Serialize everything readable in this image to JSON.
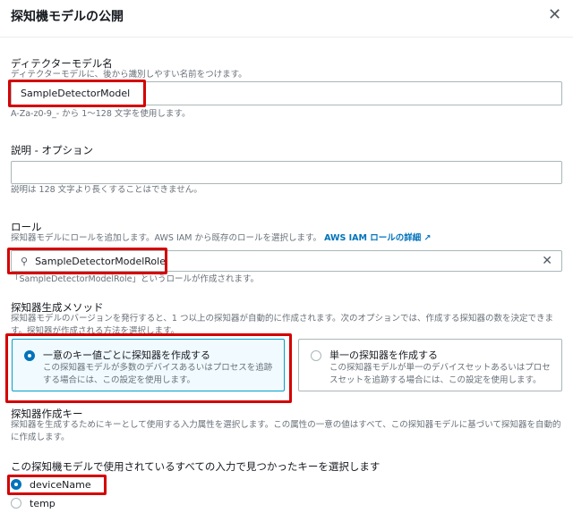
{
  "dialog": {
    "title": "探知機モデルの公開",
    "close_icon": "close-icon"
  },
  "name_field": {
    "label": "ディテクターモデル名",
    "description": "ディテクターモデルに、後から識別しやすい名前をつけます。",
    "value": "SampleDetectorModel",
    "help": "A-Za-z0-9_- から 1～128 文字を使用します。"
  },
  "description_field": {
    "label": "説明 - オプション",
    "value": "",
    "help": "説明は 128 文字より長くすることはできません。"
  },
  "role_field": {
    "label": "ロール",
    "description": "探知器モデルにロールを追加します。AWS IAM から既存のロールを選択します。",
    "link": "AWS IAM ロールの詳細",
    "value": "SampleDetectorModelRole",
    "help": "「SampleDetectorModelRole」というロールが作成されます。"
  },
  "method": {
    "label": "探知器生成メソッド",
    "description": "探知器モデルのバージョンを発行すると、1 つ以上の探知器が自動的に作成されます。次のオプションでは、作成する探知器の数を決定できます。探知器が作成される方法を選択します。",
    "options": [
      {
        "title": "一意のキー値ごとに探知器を作成する",
        "description": "この探知器モデルが多数のデバイスあるいはプロセスを追跡する場合には、この設定を使用します。",
        "selected": true
      },
      {
        "title": "単一の探知器を作成する",
        "description": "この探知器モデルが単一のデバイスセットあるいはプロセスセットを追跡する場合には、この設定を使用します。",
        "selected": false
      }
    ]
  },
  "key": {
    "label": "探知器作成キー",
    "description": "探知器を生成するためにキーとして使用する入力属性を選択します。この属性の一意の値はすべて、この探知器モデルに基づいて探知器を自動的に作成します。",
    "select_label": "この探知機モデルで使用されているすべての入力で見つかったキーを選択します",
    "options": [
      {
        "label": "deviceName",
        "selected": true
      },
      {
        "label": "temp",
        "selected": false
      }
    ]
  },
  "colors": {
    "accent": "#0073bb",
    "highlight": "#d40000"
  }
}
